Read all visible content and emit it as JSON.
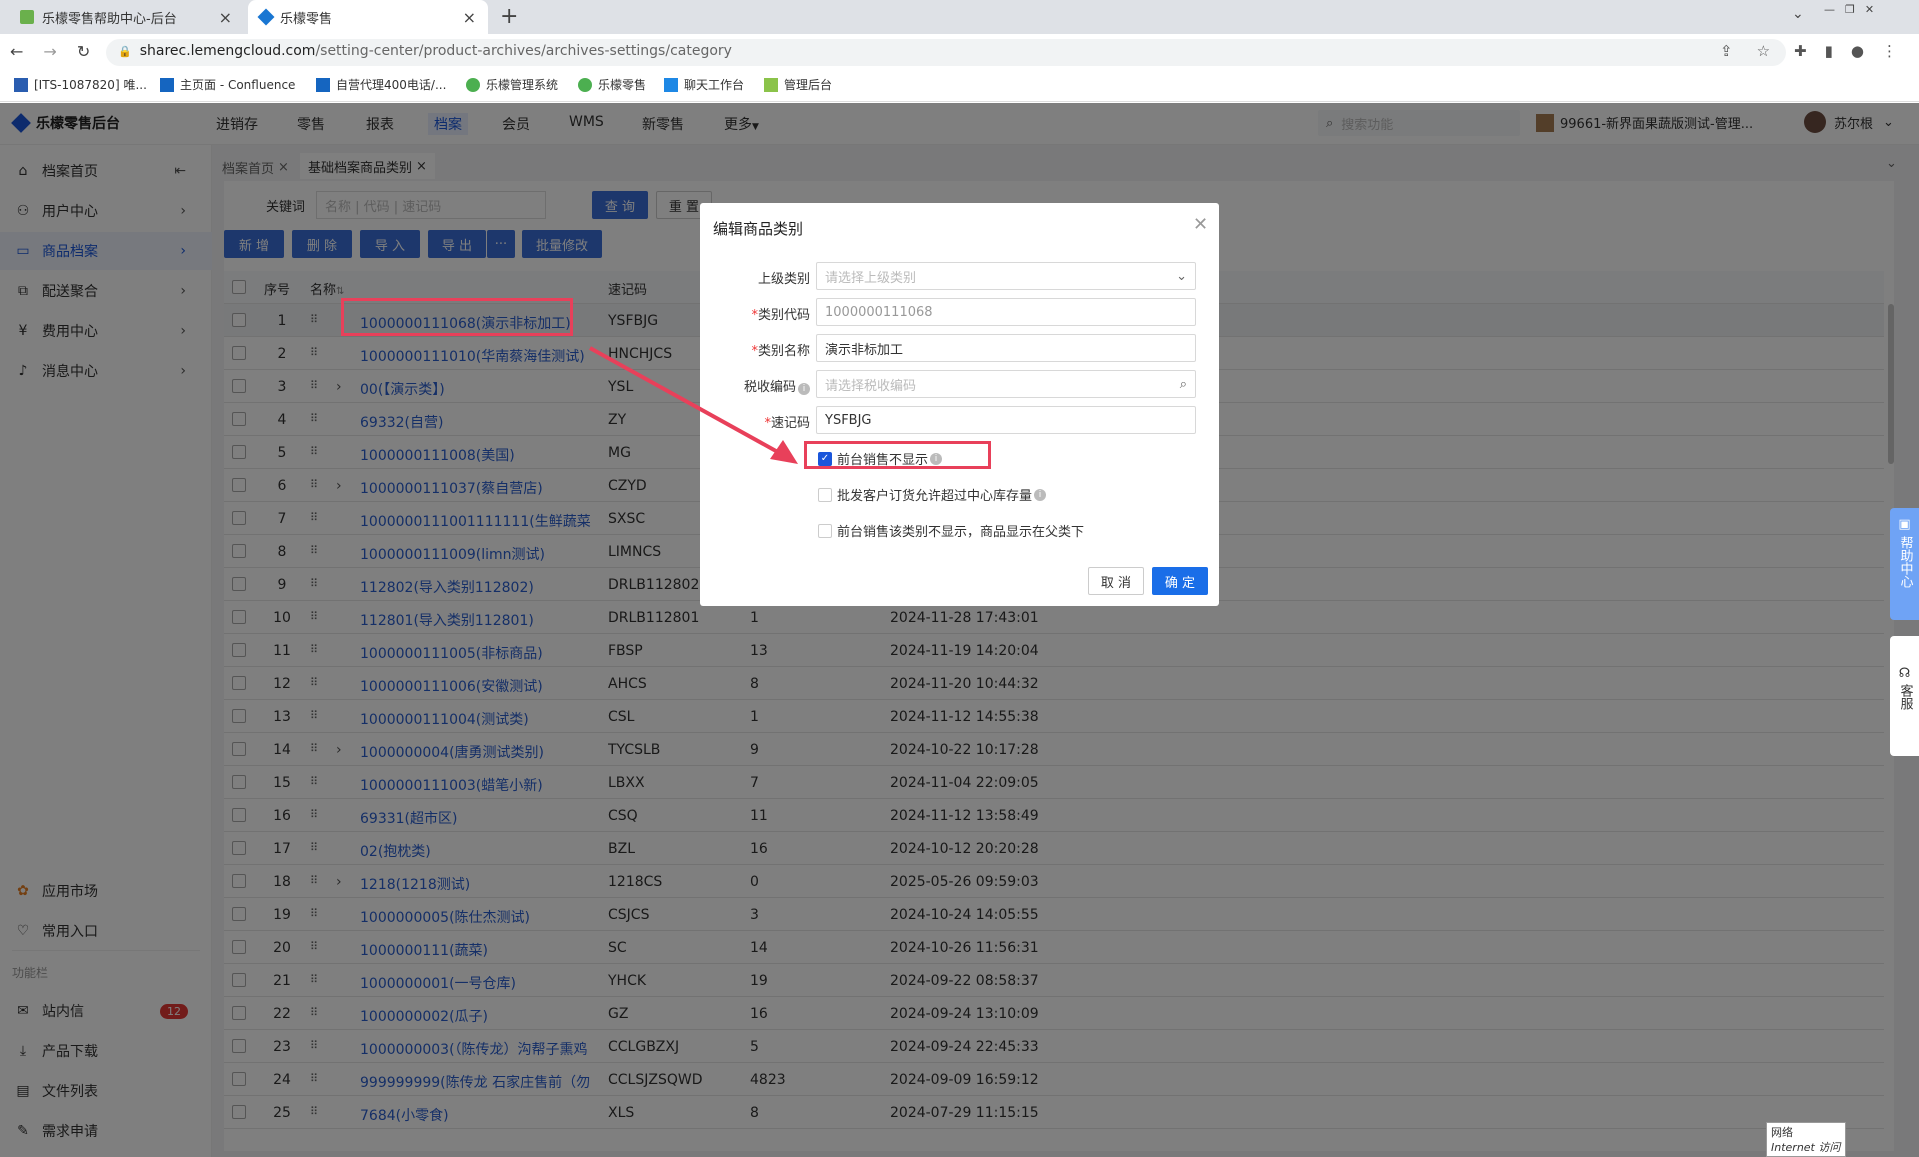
{
  "browser": {
    "tabs": [
      {
        "title": "乐檬零售帮助中心-后台"
      },
      {
        "title": "乐檬零售"
      }
    ],
    "url_host": "sharec.lemengcloud.com",
    "url_path": "/setting-center/product-archives/archives-settings/category",
    "bookmarks": [
      "[ITS-1087820] 唯...",
      "主页面 - Confluence",
      "自营代理400电话/...",
      "乐檬管理系统",
      "乐檬零售",
      "聊天工作台",
      "管理后台"
    ]
  },
  "app": {
    "logo": "乐檬零售后台",
    "nav": [
      "进销存",
      "零售",
      "报表",
      "档案",
      "会员",
      "WMS",
      "新零售",
      "更多"
    ],
    "search_placeholder": "搜索功能",
    "store": "99661-新界面果蔬版测试-管理...",
    "user": "苏尔根"
  },
  "sidebar": {
    "items": [
      {
        "label": "档案首页"
      },
      {
        "label": "用户中心"
      },
      {
        "label": "商品档案"
      },
      {
        "label": "配送聚合"
      },
      {
        "label": "费用中心"
      },
      {
        "label": "消息中心"
      }
    ],
    "bottom": [
      {
        "label": "应用市场"
      },
      {
        "label": "常用入口"
      }
    ],
    "section": "功能栏",
    "tools": [
      {
        "label": "站内信",
        "badge": "12"
      },
      {
        "label": "产品下载"
      },
      {
        "label": "文件列表"
      },
      {
        "label": "需求申请"
      }
    ]
  },
  "page": {
    "tabs": [
      "档案首页",
      "基础档案商品类别"
    ],
    "keyword_label": "关键词",
    "keyword_placeholder": "名称 | 代码 | 速记码",
    "query": "查 询",
    "reset": "重 置",
    "actions": [
      "新 增",
      "删 除",
      "导 入",
      "导 出",
      "···",
      "批量修改"
    ],
    "headers": {
      "seq": "序号",
      "name": "名称",
      "code": "速记码"
    },
    "rows": [
      {
        "seq": "1",
        "name": "1000000111068(演示非标加工)",
        "code": "YSFBJG",
        "num": "",
        "time": ""
      },
      {
        "seq": "2",
        "name": "1000000111010(华南蔡海佳测试)",
        "code": "HNCHJCS",
        "num": "",
        "time": ""
      },
      {
        "seq": "3",
        "name": "00(【演示类】)",
        "code": "YSL",
        "num": "",
        "time": ""
      },
      {
        "seq": "4",
        "name": "69332(自营)",
        "code": "ZY",
        "num": "",
        "time": ""
      },
      {
        "seq": "5",
        "name": "1000000111008(美国)",
        "code": "MG",
        "num": "",
        "time": ""
      },
      {
        "seq": "6",
        "name": "1000000111037(蔡自营店)",
        "code": "CZYD",
        "num": "",
        "time": ""
      },
      {
        "seq": "7",
        "name": "1000000111001111111(生鲜蔬菜",
        "code": "SXSC",
        "num": "",
        "time": ""
      },
      {
        "seq": "8",
        "name": "1000000111009(limn测试)",
        "code": "LIMNCS",
        "num": "",
        "time": ""
      },
      {
        "seq": "9",
        "name": "112802(导入类别112802)",
        "code": "DRLB112802",
        "num": "",
        "time": ""
      },
      {
        "seq": "10",
        "name": "112801(导入类别112801)",
        "code": "DRLB112801",
        "num": "1",
        "time": "2024-11-28 17:43:01"
      },
      {
        "seq": "11",
        "name": "1000000111005(非标商品)",
        "code": "FBSP",
        "num": "13",
        "time": "2024-11-19 14:20:04"
      },
      {
        "seq": "12",
        "name": "1000000111006(安徽测试)",
        "code": "AHCS",
        "num": "8",
        "time": "2024-11-20 10:44:32"
      },
      {
        "seq": "13",
        "name": "1000000111004(测试类)",
        "code": "CSL",
        "num": "1",
        "time": "2024-11-12 14:55:38"
      },
      {
        "seq": "14",
        "name": "1000000004(唐勇测试类别)",
        "code": "TYCSLB",
        "num": "9",
        "time": "2024-10-22 10:17:28"
      },
      {
        "seq": "15",
        "name": "1000000111003(蜡笔小新)",
        "code": "LBXX",
        "num": "7",
        "time": "2024-11-04 22:09:05"
      },
      {
        "seq": "16",
        "name": "69331(超市区)",
        "code": "CSQ",
        "num": "11",
        "time": "2024-11-12 13:58:49"
      },
      {
        "seq": "17",
        "name": "02(抱枕类)",
        "code": "BZL",
        "num": "16",
        "time": "2024-10-12 20:20:28"
      },
      {
        "seq": "18",
        "name": "1218(1218测试)",
        "code": "1218CS",
        "num": "0",
        "time": "2025-05-26 09:59:03"
      },
      {
        "seq": "19",
        "name": "1000000005(陈仕杰测试)",
        "code": "CSJCS",
        "num": "3",
        "time": "2024-10-24 14:05:55"
      },
      {
        "seq": "20",
        "name": "1000000111(蔬菜)",
        "code": "SC",
        "num": "14",
        "time": "2024-10-26 11:56:31"
      },
      {
        "seq": "21",
        "name": "1000000001(一号仓库)",
        "code": "YHCK",
        "num": "19",
        "time": "2024-09-22 08:58:37"
      },
      {
        "seq": "22",
        "name": "1000000002(瓜子)",
        "code": "GZ",
        "num": "16",
        "time": "2024-09-24 13:10:09"
      },
      {
        "seq": "23",
        "name": "1000000003(（陈传龙）沟帮子熏鸡",
        "code": "CCLGBZXJ",
        "num": "5",
        "time": "2024-09-24 22:45:33"
      },
      {
        "seq": "24",
        "name": "999999999(陈传龙 石家庄售前（勿",
        "code": "CCLSJZSQWD",
        "num": "4823",
        "time": "2024-09-09 16:59:12"
      },
      {
        "seq": "25",
        "name": "7684(小零食)",
        "code": "XLS",
        "num": "8",
        "time": "2024-07-29 11:15:15"
      }
    ]
  },
  "modal": {
    "title": "编辑商品类别",
    "parent_label": "上级类别",
    "parent_placeholder": "请选择上级类别",
    "code_label": "类别代码",
    "code_value": "1000000111068",
    "name_label": "类别名称",
    "name_value": "演示非标加工",
    "tax_label": "税收编码",
    "tax_placeholder": "请选择税收编码",
    "short_label": "速记码",
    "short_value": "YSFBJG",
    "check1": "前台销售不显示",
    "check2": "批发客户订货允许超过中心库存量",
    "check3": "前台销售该类别不显示，商品显示在父类下",
    "cancel": "取 消",
    "ok": "确 定"
  },
  "float": {
    "help": "帮助中心",
    "service": "客服"
  },
  "network": {
    "line1": "网络",
    "line2": "Internet 访问"
  }
}
